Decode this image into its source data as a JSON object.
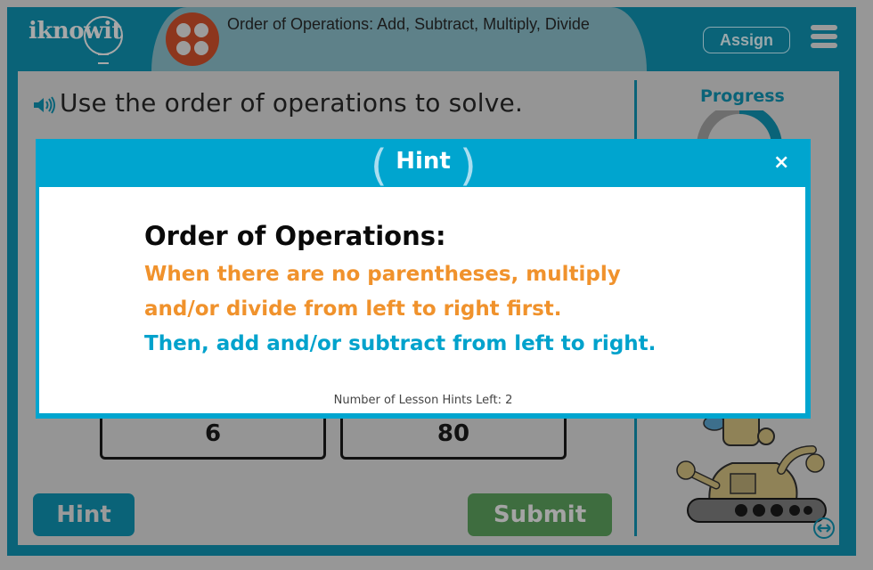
{
  "header": {
    "logo_text": "iknowit",
    "lesson_title": "Order of Operations: Add, Subtract, Multiply, Divide",
    "assign_label": "Assign",
    "menu_icon": "hamburger-menu-icon"
  },
  "question": {
    "speaker_icon": "speaker-icon",
    "prompt": "Use the order of operations to solve.",
    "answers": [
      "6",
      "80"
    ]
  },
  "sidebar": {
    "progress_label": "Progress",
    "progress_fraction": 0.5,
    "expand_icon": "expand-arrows-icon"
  },
  "buttons": {
    "hint": "Hint",
    "submit": "Submit"
  },
  "hint_modal": {
    "title": "Hint",
    "close": "×",
    "heading": "Order of Operations:",
    "line1": "When there are no parentheses, multiply",
    "line2": "and/or divide from left to right first.",
    "line3": "Then, add and/or subtract from left to right.",
    "hints_left": "Number of Lesson Hints Left: 2"
  },
  "colors": {
    "brand_teal": "#0a6378",
    "modal_blue": "#00a5cf",
    "orange": "#f0922c",
    "blue_text": "#00a2cc",
    "submit_green": "#3e6d3f",
    "lesson_icon": "#8d361d"
  }
}
